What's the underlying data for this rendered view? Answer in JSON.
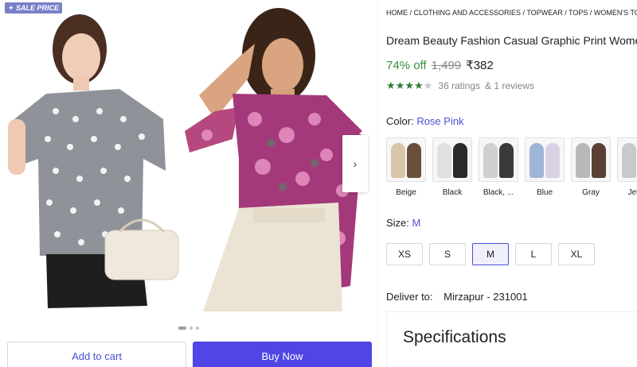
{
  "gallery": {
    "badge": "SALE PRICE",
    "next_icon": "chevron-right-icon",
    "dot_count": 3,
    "active_dot": 0
  },
  "actions": {
    "add_to_cart": "Add to cart",
    "buy_now": "Buy Now"
  },
  "product": {
    "breadcrumb": "HOME / CLOTHING AND ACCESSORIES / TOPWEAR / TOPS / WOMEN'S TOPS / D",
    "title": "Dream Beauty Fashion Casual Graphic Print Wome",
    "discount": "74% off",
    "mrp": "1,499",
    "price": "₹382",
    "rating": 4,
    "rating_max": 5,
    "ratings_text": "36 ratings",
    "reviews_text": "& 1 reviews",
    "accent_color": "#5046e5",
    "rating_color": "#2e7d32"
  },
  "color": {
    "label": "Color:",
    "value": "Rose Pink",
    "options": [
      {
        "label": "Beige",
        "c1": "#d8c6a8",
        "c2": "#6b4f3a"
      },
      {
        "label": "Black",
        "c1": "#e0e0e0",
        "c2": "#2a2a2a"
      },
      {
        "label": "Black, ...",
        "c1": "#cfcfcf",
        "c2": "#3a3a3a"
      },
      {
        "label": "Blue",
        "c1": "#9fb6d8",
        "c2": "#d9d2e6"
      },
      {
        "label": "Gray",
        "c1": "#b9b9b9",
        "c2": "#5a4034"
      },
      {
        "label": "Jet B",
        "c1": "#c9c9c9",
        "c2": "#e8e8e8"
      }
    ]
  },
  "size": {
    "label": "Size:",
    "value": "M",
    "options": [
      "XS",
      "S",
      "M",
      "L",
      "XL"
    ],
    "selected": 2
  },
  "delivery": {
    "label": "Deliver to:",
    "value": "Mirzapur - 231001"
  },
  "specs": {
    "title": "Specifications"
  }
}
